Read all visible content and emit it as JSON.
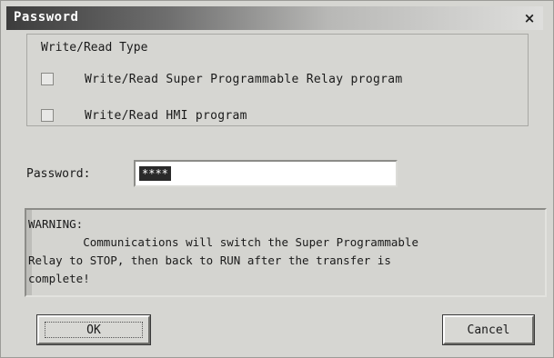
{
  "dialog": {
    "title": "Password",
    "close_glyph": "×"
  },
  "type_group": {
    "legend": "Write/Read Type",
    "options": [
      {
        "label": "Write/Read Super Programmable Relay program",
        "checked": false
      },
      {
        "label": "Write/Read HMI program",
        "checked": false
      }
    ]
  },
  "password": {
    "label": "Password:",
    "value": "****"
  },
  "warning": {
    "text": "WARNING:\n        Communications will switch the Super Programmable\nRelay to STOP, then back to RUN after the transfer is\ncomplete!"
  },
  "buttons": {
    "ok_label": "OK",
    "cancel_label": "Cancel"
  },
  "icons": {
    "close": "close-icon",
    "checkbox": "checkbox-icon"
  },
  "colors": {
    "titlebar_start": "#3c3c3c",
    "titlebar_end": "#dededc",
    "window_bg": "#d6d6d2"
  }
}
